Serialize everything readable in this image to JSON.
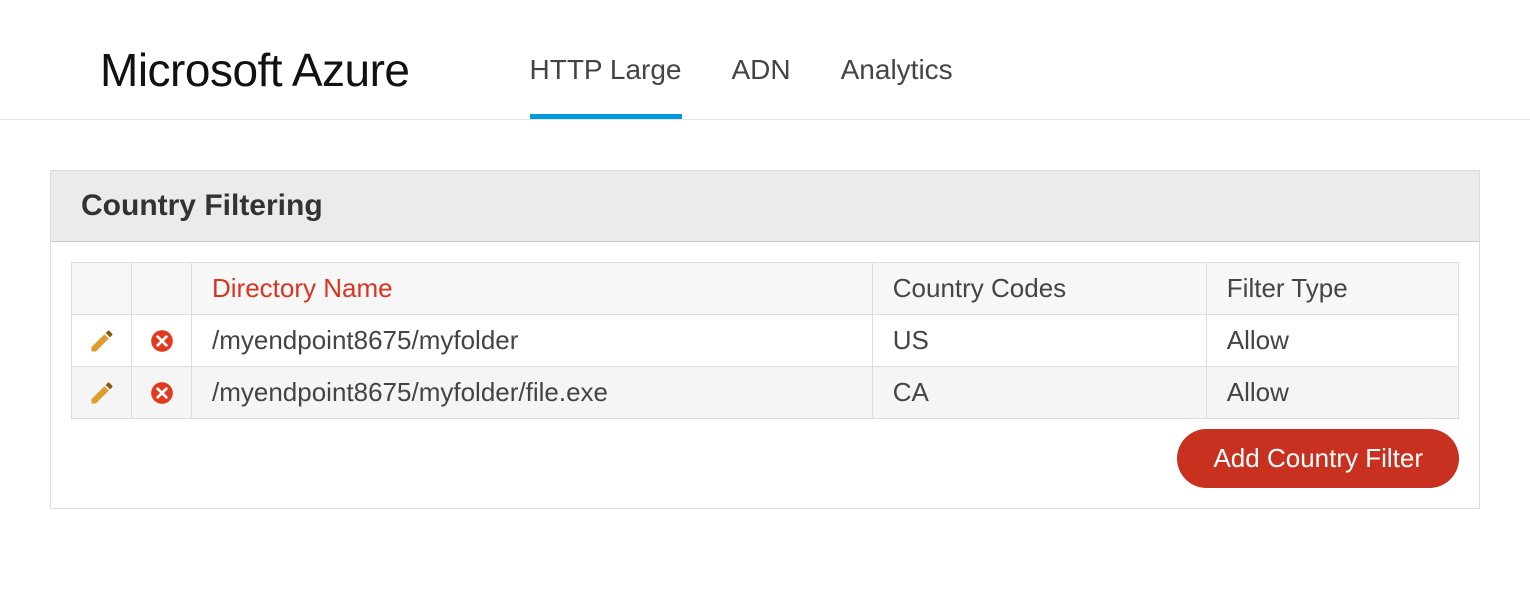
{
  "header": {
    "logo": "Microsoft Azure",
    "tabs": [
      {
        "label": "HTTP Large",
        "active": true
      },
      {
        "label": "ADN",
        "active": false
      },
      {
        "label": "Analytics",
        "active": false
      }
    ]
  },
  "panel": {
    "title": "Country Filtering",
    "columns": {
      "directory": "Directory Name",
      "codes": "Country Codes",
      "filter": "Filter Type"
    },
    "rows": [
      {
        "directory": "/myendpoint8675/myfolder",
        "codes": "US",
        "filter": "Allow"
      },
      {
        "directory": "/myendpoint8675/myfolder/file.exe",
        "codes": "CA",
        "filter": "Allow"
      }
    ],
    "add_button": "Add Country Filter"
  }
}
